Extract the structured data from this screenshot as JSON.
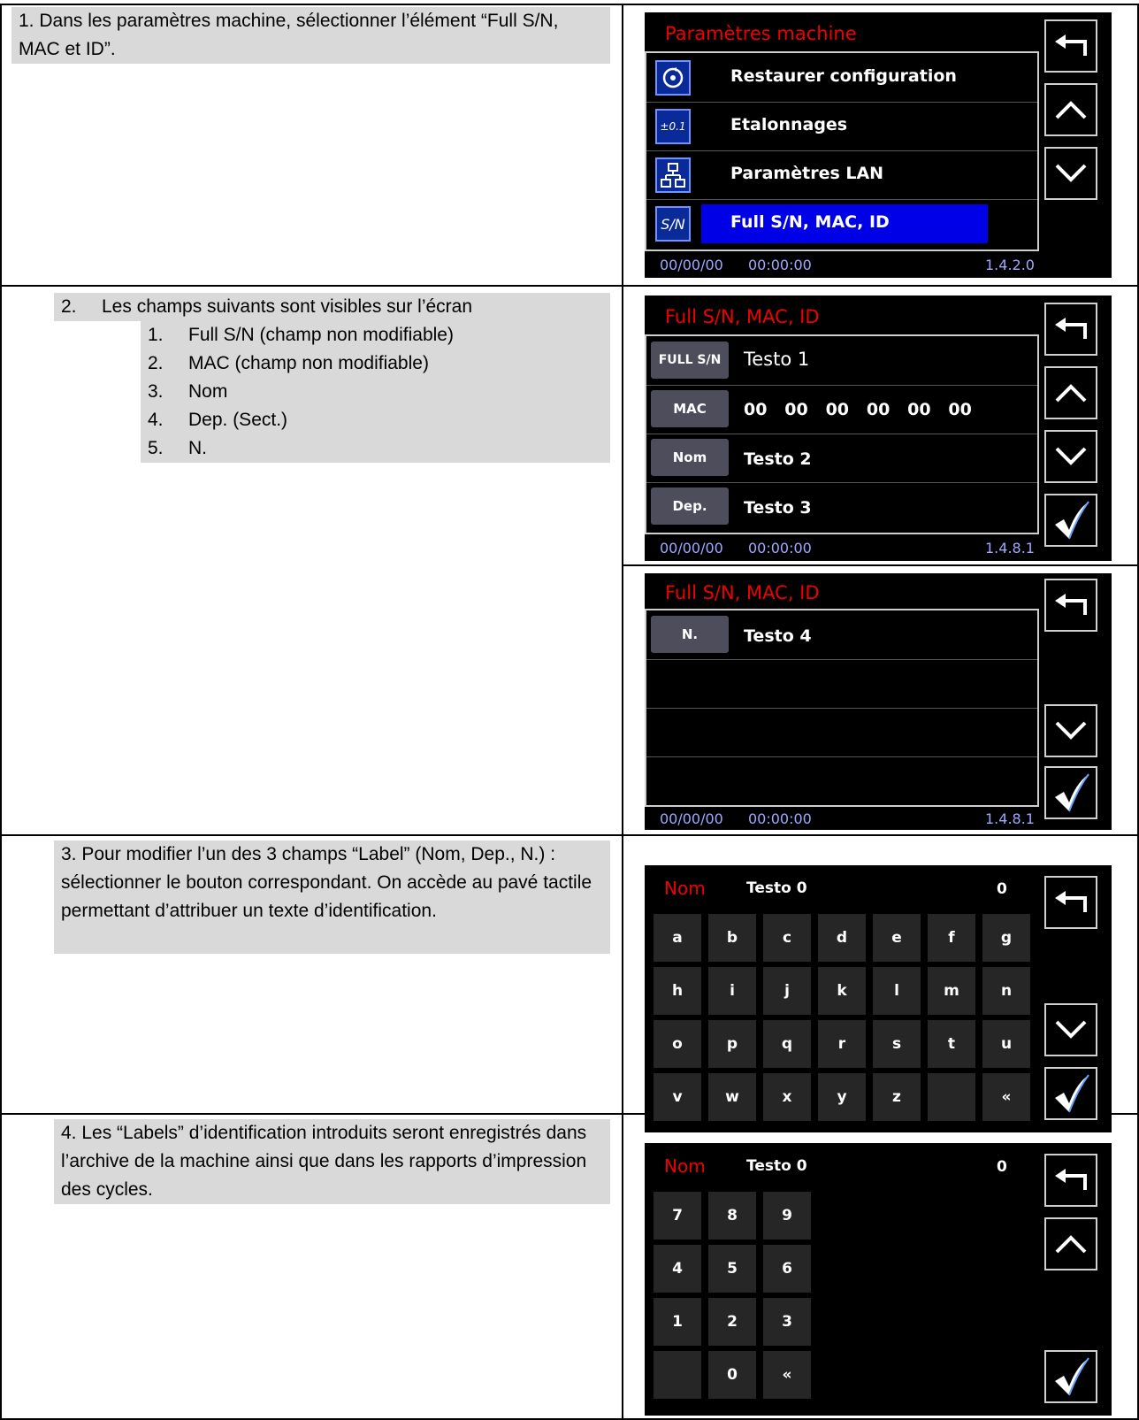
{
  "steps": {
    "s1": {
      "text": "1. Dans les paramètres machine, sélectionner l’élément “Full S/N, MAC et ID”."
    },
    "s2": {
      "intro_num": "2.",
      "intro": "Les champs suivants sont visibles sur l’écran",
      "items": [
        {
          "num": "1.",
          "label": "Full S/N (champ non modifiable)"
        },
        {
          "num": "2.",
          "label": "MAC (champ non modifiable)"
        },
        {
          "num": "3.",
          "label": "Nom"
        },
        {
          "num": "4.",
          "label": "Dep. (Sect.)"
        },
        {
          "num": "5.",
          "label": "N."
        }
      ]
    },
    "s3": {
      "text": "3.  Pour modifier l’un des 3 champs “Label” (Nom, Dep., N.) : sélectionner le bouton correspondant. On accède au pavé tactile permettant d’attribuer un texte d’identification."
    },
    "s4": {
      "text": "4. Les “Labels” d’identification introduits seront enregistrés dans l’archive de la machine ainsi que dans les rapports d’impression des cycles."
    }
  },
  "screen1": {
    "title": "Paramètres machine",
    "items": [
      {
        "icon": "restore-icon",
        "label": "Restaurer configuration"
      },
      {
        "icon": "calibration-icon",
        "icon_text": "±0.1",
        "label": "Etalonnages"
      },
      {
        "icon": "network-icon",
        "label": "Paramètres LAN"
      },
      {
        "icon": "serial-icon",
        "icon_text": "S/N",
        "label": "Full S/N, MAC, ID",
        "selected": true
      }
    ],
    "date": "00/00/00",
    "time": "00:00:00",
    "version": "1.4.2.0"
  },
  "screen2": {
    "title": "Full S/N, MAC, ID",
    "fields": [
      {
        "button": "FULL S/N",
        "value": "Testo 1"
      },
      {
        "button": "MAC",
        "value": "00   00   00   00   00   00"
      },
      {
        "button": "Nom",
        "value": "Testo 2"
      },
      {
        "button": "Dep.",
        "value": "Testo 3"
      }
    ],
    "date": "00/00/00",
    "time": "00:00:00",
    "version": "1.4.8.1"
  },
  "screen3": {
    "title": "Full S/N, MAC, ID",
    "fields": [
      {
        "button": "N.",
        "value": "Testo 4"
      }
    ],
    "date": "00/00/00",
    "time": "00:00:00",
    "version": "1.4.8.1"
  },
  "keyboard_alpha": {
    "field": "Nom",
    "text": "Testo 0",
    "count": "0",
    "keys": [
      "a",
      "b",
      "c",
      "d",
      "e",
      "f",
      "g",
      "h",
      "i",
      "j",
      "k",
      "l",
      "m",
      "n",
      "o",
      "p",
      "q",
      "r",
      "s",
      "t",
      "u",
      "v",
      "w",
      "x",
      "y",
      "z",
      "",
      "«"
    ]
  },
  "keyboard_num": {
    "field": "Nom",
    "text": "Testo 0",
    "count": "0",
    "keys": [
      "7",
      "8",
      "9",
      "4",
      "5",
      "6",
      "1",
      "2",
      "3",
      "",
      "0",
      "«"
    ]
  },
  "icons": {
    "back": "back-arrow-icon",
    "up": "chevron-up-icon",
    "down": "chevron-down-icon",
    "confirm": "checkmark-icon"
  },
  "colors": {
    "title_red": "#e00000",
    "selection_blue": "#0000e6",
    "field_button": "#4d4d5c",
    "status_blue": "#9fa8ff"
  }
}
